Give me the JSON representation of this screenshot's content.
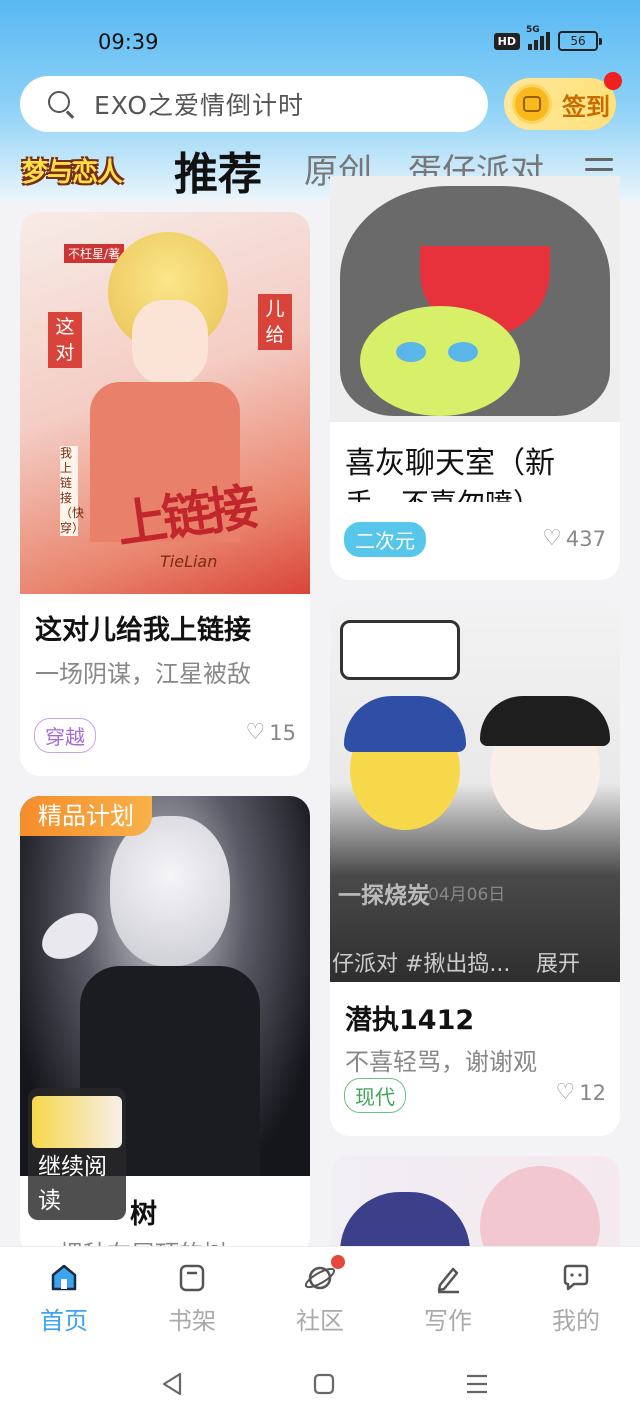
{
  "status_bar": {
    "time": "09:39",
    "hd": "HD",
    "network": "5G",
    "battery": "56"
  },
  "search": {
    "placeholder": "EXO之爱情倒计时",
    "signin_label": "签到"
  },
  "tabs": {
    "logo": "梦与恋人",
    "items": [
      "推荐",
      "原创",
      "蛋仔派对"
    ],
    "active": "推荐"
  },
  "cards": [
    {
      "title": "这对儿给我上链接",
      "desc": "一场阴谋，江星被敌",
      "tag": "穿越",
      "likes": "15",
      "cover_text": [
        "不枉星/著",
        "这对",
        "儿给",
        "上链接",
        "我上链接（快穿）",
        "TieLian"
      ]
    },
    {
      "title": "喜灰聊天室（新",
      "desc": "手，不喜勿喷）",
      "tag": "二次元",
      "likes": "437"
    },
    {
      "title": "潜执1412",
      "desc": "不喜轻骂，谢谢观",
      "tag": "现代",
      "likes": "12",
      "cover_caption": "一探烧炭",
      "cover_date": "04月06日",
      "cover_hashtag": "仔派对 #揪出捣...",
      "cover_expand": "展开"
    },
    {
      "badge": "精品计划",
      "title": "树",
      "desc": "一棵种在屋顶的树"
    },
    {
      "title": ""
    }
  ],
  "mini_player": {
    "text": "继续阅读"
  },
  "bottom_nav": [
    {
      "label": "首页",
      "icon": "home-icon",
      "active": true
    },
    {
      "label": "书架",
      "icon": "bookshelf-icon",
      "active": false
    },
    {
      "label": "社区",
      "icon": "planet-icon",
      "active": false
    },
    {
      "label": "写作",
      "icon": "pen-icon",
      "active": false
    },
    {
      "label": "我的",
      "icon": "chat-profile-icon",
      "active": false
    }
  ],
  "colors": {
    "accent": "#3aa3f2",
    "header_top": "#58b9f3",
    "signin_bg": "#ffe27a",
    "badge_orange": "#f58d2b",
    "notify_red": "#f0201e"
  }
}
